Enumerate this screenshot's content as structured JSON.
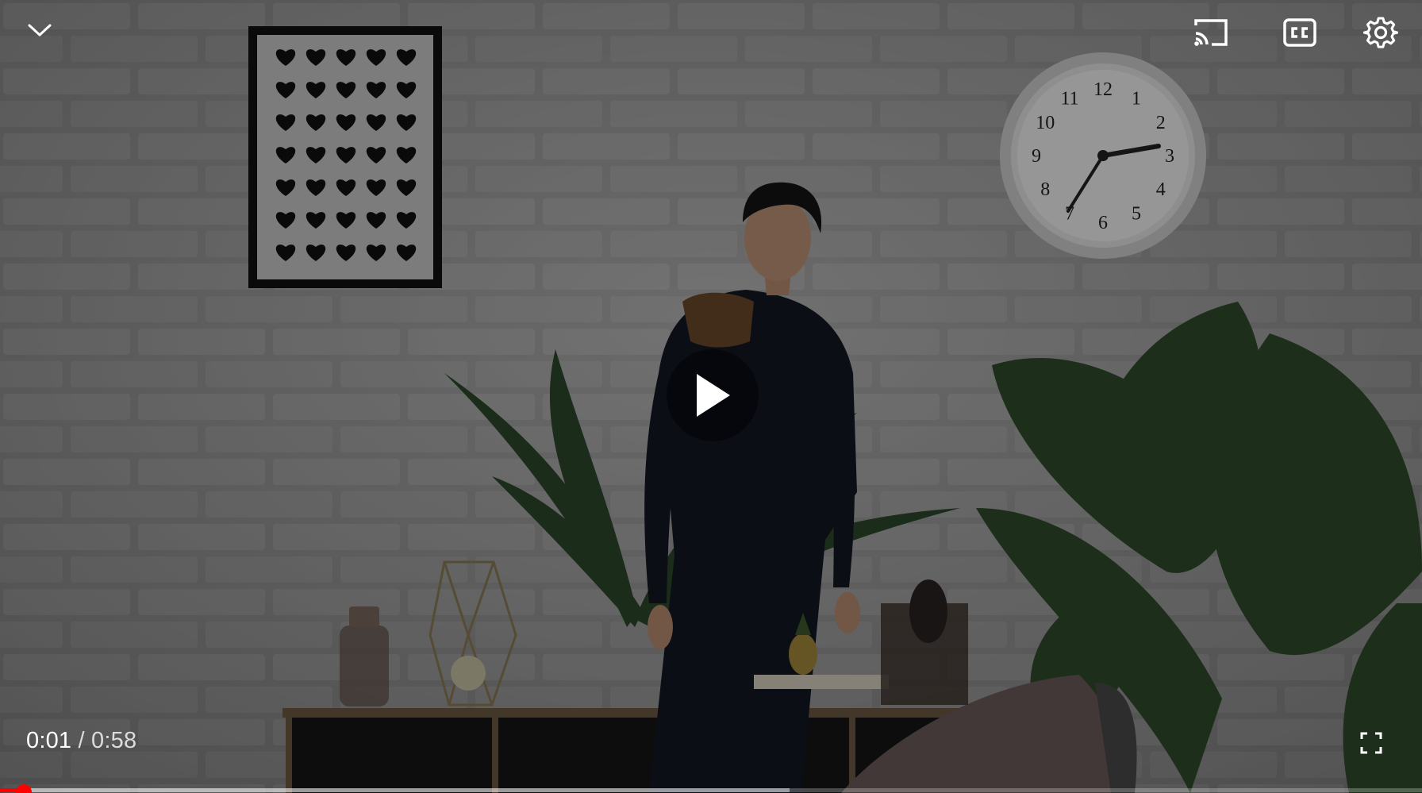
{
  "player": {
    "current_time": "0:01",
    "separator": "/",
    "duration": "0:58",
    "progress_fraction": 0.017,
    "buffered_fraction": 0.555,
    "accent_color": "#ff0000"
  },
  "icons": {
    "collapse": "chevron-down-icon",
    "cast": "cast-icon",
    "captions": "closed-captions-icon",
    "settings": "gear-icon",
    "play": "play-icon",
    "fullscreen": "fullscreen-icon"
  },
  "scene": {
    "clock_numbers": [
      "12",
      "1",
      "2",
      "3",
      "4",
      "5",
      "6",
      "7",
      "8",
      "9",
      "10",
      "11"
    ]
  }
}
